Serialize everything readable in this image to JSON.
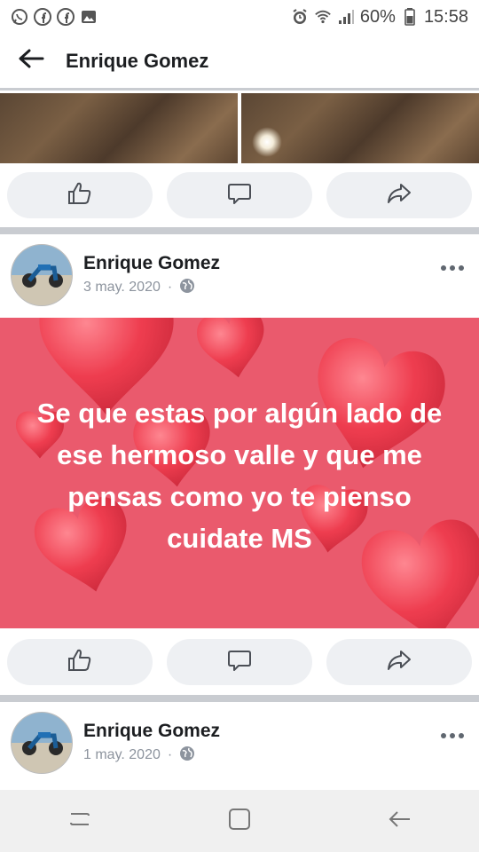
{
  "status_bar": {
    "left_icons": [
      "whatsapp-icon",
      "facebook-icon",
      "facebook-icon",
      "gallery-icon"
    ],
    "battery": "60%",
    "time": "15:58"
  },
  "header": {
    "title": "Enrique Gomez"
  },
  "posts": [
    {
      "author": "Enrique Gomez",
      "date": "3 may. 2020",
      "separator": "·",
      "privacy_icon": "globe-icon",
      "text": "Se que estas por algún lado de ese hermoso valle y que me pensas como yo te pienso cuidate MS",
      "background_color": "#ea5a6d"
    },
    {
      "author": "Enrique Gomez",
      "date": "1 may. 2020",
      "separator": "·",
      "privacy_icon": "globe-icon"
    }
  ],
  "actions": {
    "like_icon": "thumbs-up-icon",
    "comment_icon": "comment-icon",
    "share_icon": "share-icon"
  },
  "colors": {
    "accent": "#1c1e21",
    "meta": "#8d949e",
    "button_bg": "#eef0f3",
    "divider": "#c9ccd1"
  }
}
